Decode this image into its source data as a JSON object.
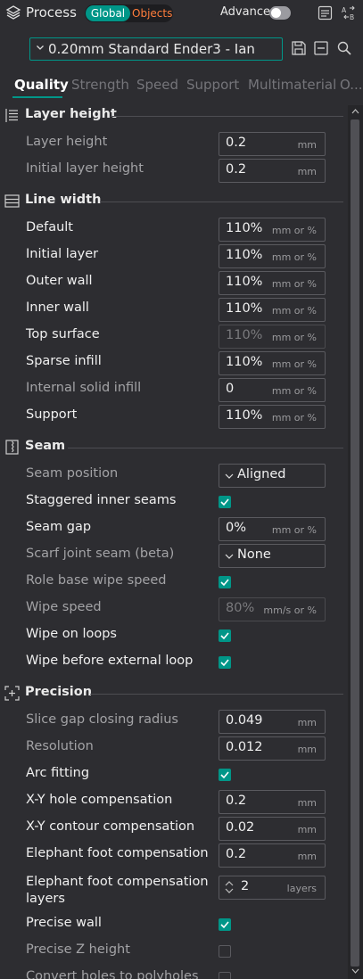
{
  "header": {
    "title": "Process",
    "toggle": {
      "global": "Global",
      "objects": "Objects"
    },
    "advance_label": "Advance",
    "advance_on": false
  },
  "preset": {
    "name": "0.20mm Standard Ender3 - Ian"
  },
  "tabs": [
    "Quality",
    "Strength",
    "Speed",
    "Support",
    "Multimaterial",
    "O..."
  ],
  "active_tab": "Quality",
  "colors": {
    "accent": "#009688",
    "objects": "#ff7d3b",
    "background": "#2d2d31"
  },
  "sections": {
    "layer_height": {
      "title": "Layer height",
      "icon": "layer-height-icon",
      "rows": [
        {
          "label": "Layer height",
          "value": "0.2",
          "unit": "mm"
        },
        {
          "label": "Initial layer height",
          "value": "0.2",
          "unit": "mm"
        }
      ]
    },
    "line_width": {
      "title": "Line width",
      "icon": "line-width-icon",
      "rows": [
        {
          "label": "Default",
          "value": "110%",
          "unit": "mm or %"
        },
        {
          "label": "Initial layer",
          "value": "110%",
          "unit": "mm or %"
        },
        {
          "label": "Outer wall",
          "value": "110%",
          "unit": "mm or %"
        },
        {
          "label": "Inner wall",
          "value": "110%",
          "unit": "mm or %"
        },
        {
          "label": "Top surface",
          "value": "110%",
          "unit": "mm or %"
        },
        {
          "label": "Sparse infill",
          "value": "110%",
          "unit": "mm or %"
        },
        {
          "label": "Internal solid infill",
          "value": "0",
          "unit": "mm or %"
        },
        {
          "label": "Support",
          "value": "110%",
          "unit": "mm or %"
        }
      ]
    },
    "seam": {
      "title": "Seam",
      "icon": "seam-icon",
      "rows": [
        {
          "label": "Seam position",
          "value": "Aligned"
        },
        {
          "label": "Staggered inner seams",
          "checked": true
        },
        {
          "label": "Seam gap",
          "value": "0%",
          "unit": "mm or %"
        },
        {
          "label": "Scarf joint seam (beta)",
          "value": "None"
        },
        {
          "label": "Role base wipe speed",
          "checked": true
        },
        {
          "label": "Wipe speed",
          "value": "80%",
          "unit": "mm/s or %"
        },
        {
          "label": "Wipe on loops",
          "checked": true
        },
        {
          "label": "Wipe before external loop",
          "checked": true
        }
      ]
    },
    "precision": {
      "title": "Precision",
      "icon": "precision-icon",
      "rows": [
        {
          "label": "Slice gap closing radius",
          "value": "0.049",
          "unit": "mm"
        },
        {
          "label": "Resolution",
          "value": "0.012",
          "unit": "mm"
        },
        {
          "label": "Arc fitting",
          "checked": true
        },
        {
          "label": "X-Y hole compensation",
          "value": "0.2",
          "unit": "mm"
        },
        {
          "label": "X-Y contour compensation",
          "value": "0.02",
          "unit": "mm"
        },
        {
          "label": "Elephant foot compensation",
          "value": "0.2",
          "unit": "mm"
        },
        {
          "label_line1": "Elephant foot compensation",
          "label_line2": "layers",
          "value": "2",
          "unit": "layers"
        },
        {
          "label": "Precise wall",
          "checked": true
        },
        {
          "label": "Precise Z height",
          "checked": false
        },
        {
          "label": "Convert holes to polyholes",
          "checked": false
        }
      ]
    }
  }
}
